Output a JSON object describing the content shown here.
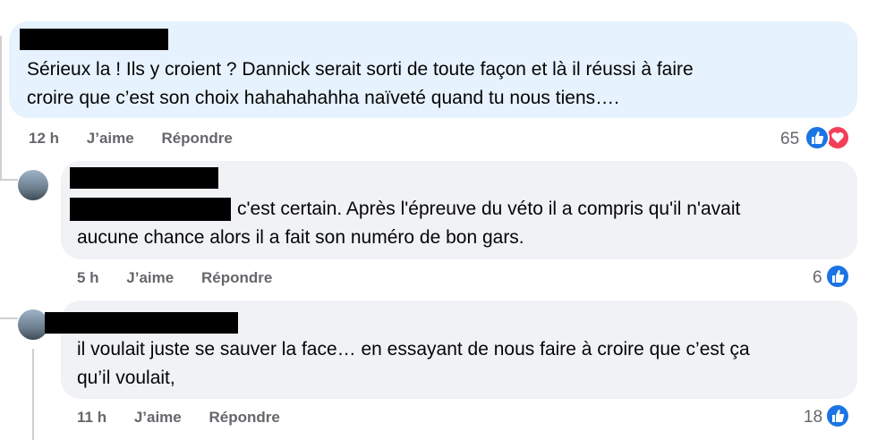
{
  "comments": [
    {
      "text_line1": "Sérieux la ! Ils y croient ? Dannick serait sorti de toute façon et là il réussi à faire",
      "text_line2": "croire que c’est son choix hahahahahha naïveté quand tu nous tiens….",
      "time": "12 h",
      "like_label": "J’aime",
      "reply_label": "Répondre",
      "reaction_count": "65",
      "reactions": [
        "like-icon",
        "love-icon"
      ]
    },
    {
      "text_line1": "c'est certain. Après l'épreuve du véto il a compris qu'il n'avait",
      "text_line2": "aucune chance alors il a fait son numéro de bon gars.",
      "time": "5 h",
      "like_label": "J’aime",
      "reply_label": "Répondre",
      "reaction_count": "6",
      "reactions": [
        "like-icon"
      ]
    },
    {
      "text_line1": "il voulait juste se sauver la face… en essayant de nous faire à croire que c’est ça",
      "text_line2": "qu’il voulait,",
      "time": "11 h",
      "like_label": "J’aime",
      "reply_label": "Répondre",
      "reaction_count": "18",
      "reactions": [
        "like-icon"
      ]
    }
  ],
  "colors": {
    "bubble_highlight": "#e6f2fd",
    "bubble_default": "#f0f2f5",
    "meta_text": "#65676b",
    "like_blue": "#1b74e4",
    "love_red": "#f33e58"
  }
}
